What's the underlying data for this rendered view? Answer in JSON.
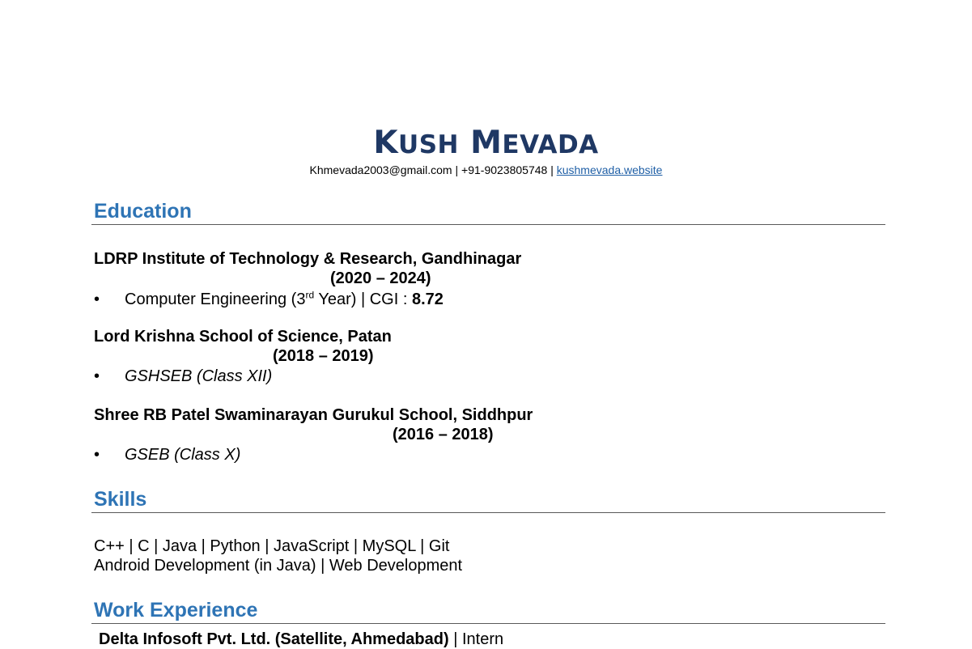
{
  "header": {
    "name_first_initial": "K",
    "name_first_rest": "USH",
    "name_last_initial": "M",
    "name_last_rest": "EVADA",
    "email": "Khmevada2003@gmail.com",
    "separator_1": " | ",
    "phone": "+91-9023805748",
    "separator_2": " | ",
    "website": "kushmevada.website "
  },
  "education": {
    "title": "Education",
    "entries": [
      {
        "institution": "LDRP Institute of Technology & Research, Gandhinagar",
        "years": "(2020 – 2024)",
        "detail_prefix": "Computer Engineering (3",
        "detail_sup": "rd",
        "detail_middle": " Year) | CGI : ",
        "detail_score": "8.72"
      },
      {
        "institution": "Lord Krishna School of Science, Patan",
        "years": "(2018 – 2019)",
        "detail": "GSHSEB (Class XII)"
      },
      {
        "institution": "Shree RB Patel Swaminarayan Gurukul School, Siddhpur",
        "years": "(2016 – 2018)",
        "detail": "GSEB (Class X)"
      }
    ]
  },
  "skills": {
    "title": "Skills",
    "line_1": "C++ | C | Java | Python | JavaScript | MySQL | Git",
    "line_2": "Android Development (in Java) | Web Development"
  },
  "work": {
    "title": "Work Experience",
    "company": "Delta Infosoft Pvt. Ltd. (Satellite, Ahmedabad)",
    "role_separator": " | ",
    "role": "Intern"
  },
  "bullet_symbol": "•",
  "colors": {
    "name": "#1f3864",
    "section_title": "#2e74b5",
    "link": "#1f5fa6",
    "rule": "#595959"
  }
}
